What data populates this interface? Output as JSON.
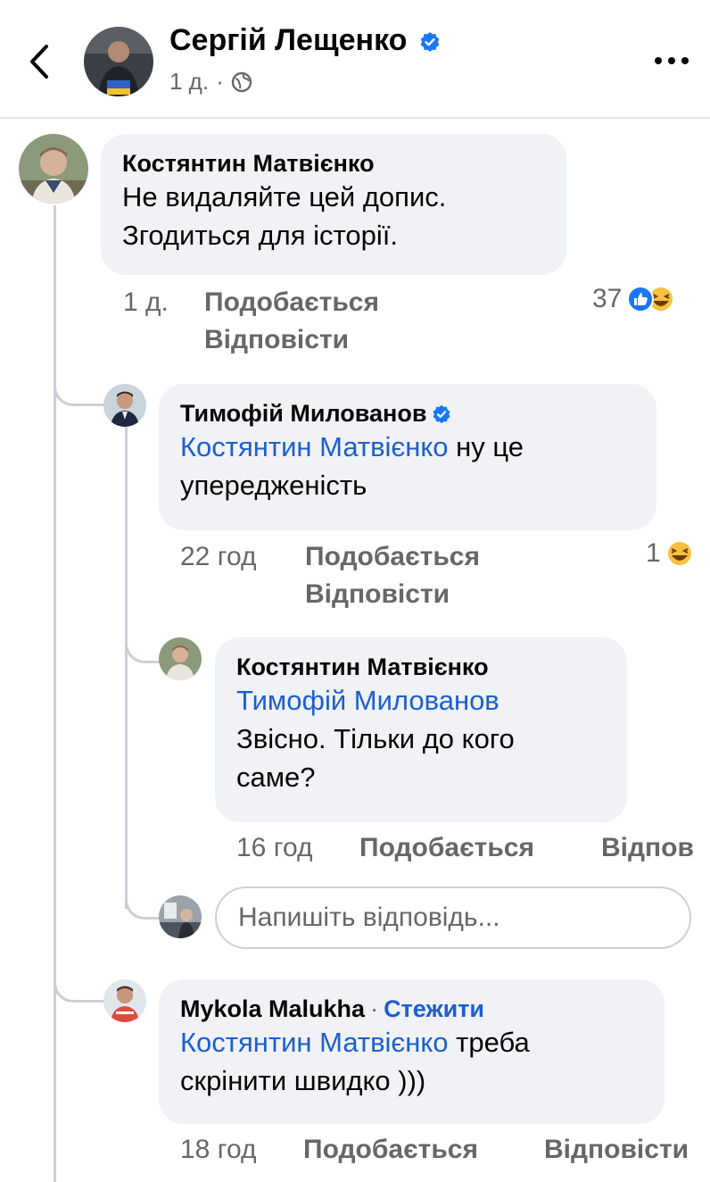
{
  "post": {
    "author": "Сергій Лещенко",
    "time": "1 д.",
    "separator": "·"
  },
  "comments": [
    {
      "author": "Костянтин Матвієнко",
      "text_line1": "Не видаляйте цей допис.",
      "text_line2": "Згодиться для історії.",
      "time": "1 д.",
      "like_label": "Подобається",
      "reply_label": "Відповісти",
      "reactions_count": "37"
    },
    {
      "author": "Тимофій Милованов",
      "mention": "Костянтин Матвієнко",
      "text_after_mention": "ну це",
      "text_line2": "упередженість",
      "time": "22 год",
      "like_label": "Подобається",
      "reply_label": "Відповісти",
      "reactions_count": "1"
    },
    {
      "author": "Костянтин Матвієнко",
      "mention": "Тимофій Милованов",
      "text_line1": "Звісно. Тільки до кого",
      "text_line2": "саме?",
      "time": "16 год",
      "like_label": "Подобається",
      "reply_label": "Відпов"
    },
    {
      "author": "Mykola Malukha",
      "separator": "·",
      "follow_label": "Стежити",
      "mention": "Костянтин Матвієнко",
      "text_after_mention": "треба",
      "text_line2": "скрінити швидко )))",
      "time": "18 год",
      "like_label": "Подобається",
      "reply_label": "Відповісти"
    }
  ],
  "reply_input": {
    "placeholder": "Напишіть відповідь..."
  },
  "colors": {
    "link": "#1b5fd1",
    "verified": "#1877f2",
    "bubble": "#f0f2f5",
    "meta": "#65676b"
  },
  "icons": [
    "back-arrow-icon",
    "verified-badge-icon",
    "globe-icon",
    "more-options-icon",
    "like-reaction-icon",
    "haha-reaction-icon"
  ]
}
